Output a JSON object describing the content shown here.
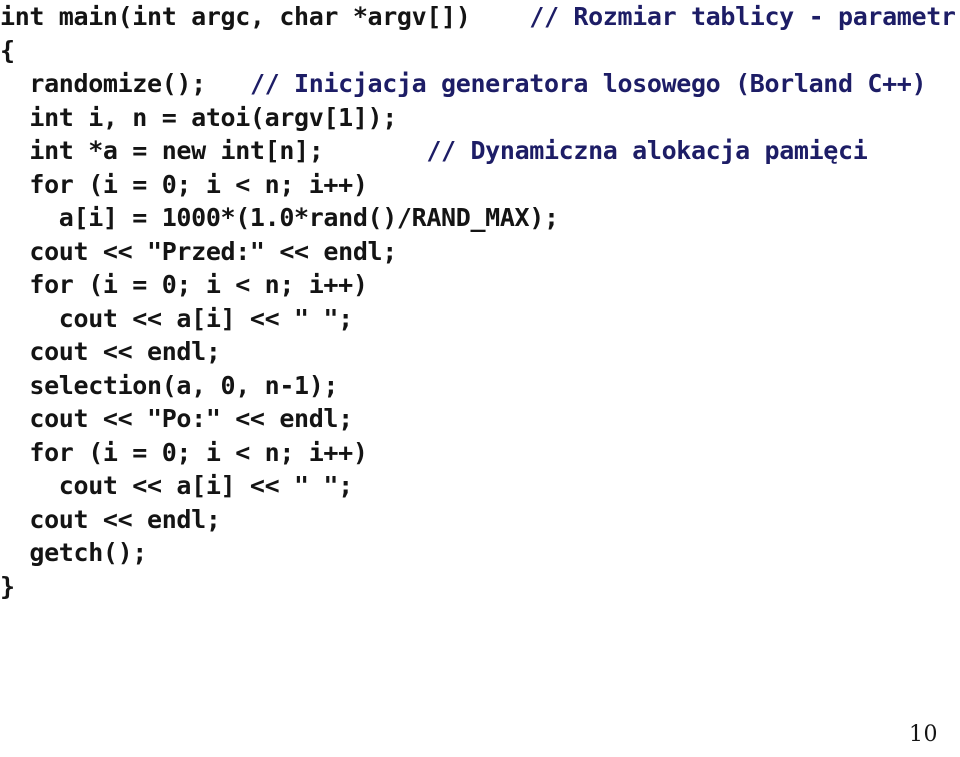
{
  "page": {
    "number": "10",
    "background_color": "#ffffff",
    "code_color": "#141414",
    "comment_color": "#1d1d66"
  },
  "code": {
    "language": "C++",
    "lines": [
      {
        "indent": 0,
        "code": "int main(int argc, char *argv[])",
        "gap": "    ",
        "comment": "// Rozmiar tablicy - parametr"
      },
      {
        "indent": 0,
        "code": "{",
        "gap": "",
        "comment": ""
      },
      {
        "indent": 2,
        "code": "randomize();",
        "gap": "   ",
        "comment": "// Inicjacja generatora losowego (Borland C++)"
      },
      {
        "indent": 2,
        "code": "int i, n = atoi(argv[1]);",
        "gap": "",
        "comment": ""
      },
      {
        "indent": 2,
        "code": "int *a = new int[n];",
        "gap": "       ",
        "comment": "// Dynamiczna alokacja pamięci"
      },
      {
        "indent": 2,
        "code": "for (i = 0; i < n; i++)",
        "gap": "",
        "comment": ""
      },
      {
        "indent": 4,
        "code": "a[i] = 1000*(1.0*rand()/RAND_MAX);",
        "gap": "",
        "comment": ""
      },
      {
        "indent": 2,
        "code": "cout << \"Przed:\" << endl;",
        "gap": "",
        "comment": ""
      },
      {
        "indent": 2,
        "code": "for (i = 0; i < n; i++)",
        "gap": "",
        "comment": ""
      },
      {
        "indent": 4,
        "code": "cout << a[i] << \" \";",
        "gap": "",
        "comment": ""
      },
      {
        "indent": 2,
        "code": "cout << endl;",
        "gap": "",
        "comment": ""
      },
      {
        "indent": 2,
        "code": "selection(a, 0, n-1);",
        "gap": "",
        "comment": ""
      },
      {
        "indent": 2,
        "code": "cout << \"Po:\" << endl;",
        "gap": "",
        "comment": ""
      },
      {
        "indent": 2,
        "code": "for (i = 0; i < n; i++)",
        "gap": "",
        "comment": ""
      },
      {
        "indent": 4,
        "code": "cout << a[i] << \" \";",
        "gap": "",
        "comment": ""
      },
      {
        "indent": 2,
        "code": "cout << endl;",
        "gap": "",
        "comment": ""
      },
      {
        "indent": 2,
        "code": "getch();",
        "gap": "",
        "comment": ""
      },
      {
        "indent": 0,
        "code": "}",
        "gap": "",
        "comment": ""
      }
    ]
  }
}
